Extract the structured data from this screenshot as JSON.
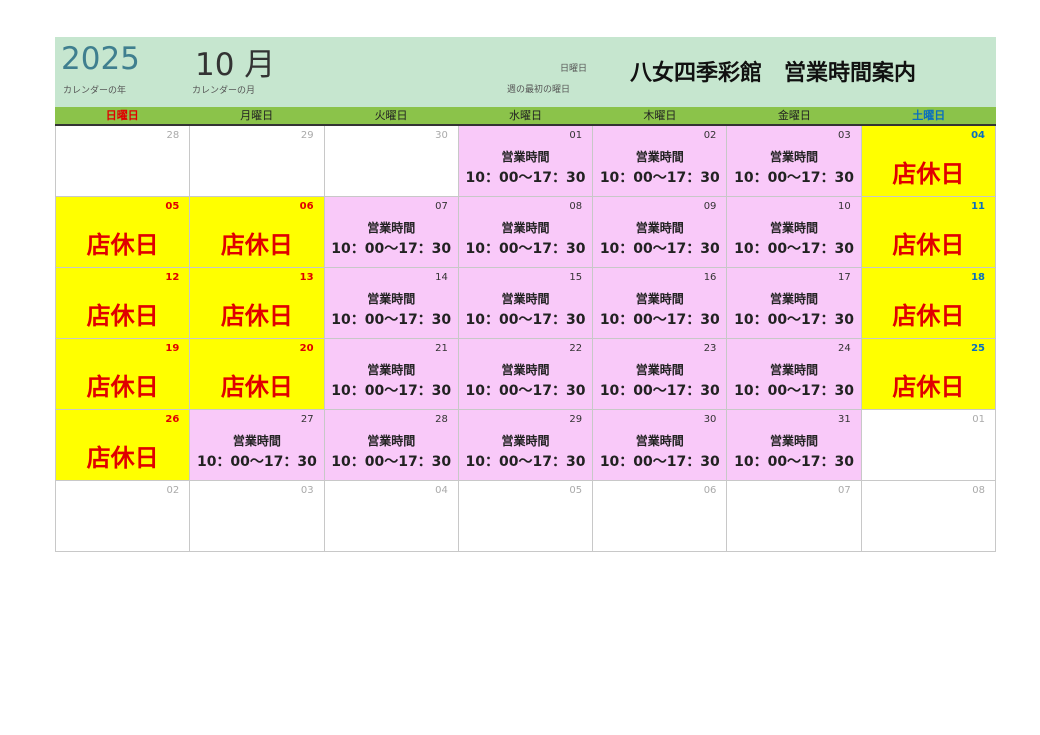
{
  "header": {
    "year": "2025",
    "year_caption": "カレンダーの年",
    "month": "10 月",
    "month_caption": "カレンダーの月",
    "start_day": "日曜日",
    "start_day_caption": "週の最初の曜日",
    "title": "八女四季彩館　営業時間案内"
  },
  "weekdays": [
    "日曜日",
    "月曜日",
    "火曜日",
    "水曜日",
    "木曜日",
    "金曜日",
    "土曜日"
  ],
  "labels": {
    "hours": "営業時間",
    "time": "10：00〜17：30",
    "closed": "店休日"
  },
  "colors": {
    "header_bg": "#c6e6cf",
    "weekday_bar": "#8bc34a",
    "open_bg": "#f9c9f9",
    "closed_bg": "#ffff00",
    "closed_text": "#e00000",
    "saturday_text": "#0a6fbf"
  },
  "days": [
    {
      "d": "28",
      "s": "other"
    },
    {
      "d": "29",
      "s": "other"
    },
    {
      "d": "30",
      "s": "other"
    },
    {
      "d": "01",
      "s": "open"
    },
    {
      "d": "02",
      "s": "open"
    },
    {
      "d": "03",
      "s": "open"
    },
    {
      "d": "04",
      "s": "closed"
    },
    {
      "d": "05",
      "s": "closed"
    },
    {
      "d": "06",
      "s": "closed"
    },
    {
      "d": "07",
      "s": "open"
    },
    {
      "d": "08",
      "s": "open"
    },
    {
      "d": "09",
      "s": "open"
    },
    {
      "d": "10",
      "s": "open"
    },
    {
      "d": "11",
      "s": "closed"
    },
    {
      "d": "12",
      "s": "closed"
    },
    {
      "d": "13",
      "s": "closed"
    },
    {
      "d": "14",
      "s": "open"
    },
    {
      "d": "15",
      "s": "open"
    },
    {
      "d": "16",
      "s": "open"
    },
    {
      "d": "17",
      "s": "open"
    },
    {
      "d": "18",
      "s": "closed"
    },
    {
      "d": "19",
      "s": "closed"
    },
    {
      "d": "20",
      "s": "closed"
    },
    {
      "d": "21",
      "s": "open"
    },
    {
      "d": "22",
      "s": "open"
    },
    {
      "d": "23",
      "s": "open"
    },
    {
      "d": "24",
      "s": "open"
    },
    {
      "d": "25",
      "s": "closed"
    },
    {
      "d": "26",
      "s": "closed"
    },
    {
      "d": "27",
      "s": "open"
    },
    {
      "d": "28",
      "s": "open"
    },
    {
      "d": "29",
      "s": "open"
    },
    {
      "d": "30",
      "s": "open"
    },
    {
      "d": "31",
      "s": "open"
    },
    {
      "d": "01",
      "s": "other"
    },
    {
      "d": "02",
      "s": "other"
    },
    {
      "d": "03",
      "s": "other"
    },
    {
      "d": "04",
      "s": "other"
    },
    {
      "d": "05",
      "s": "other"
    },
    {
      "d": "06",
      "s": "other"
    },
    {
      "d": "07",
      "s": "other"
    },
    {
      "d": "08",
      "s": "other"
    }
  ]
}
